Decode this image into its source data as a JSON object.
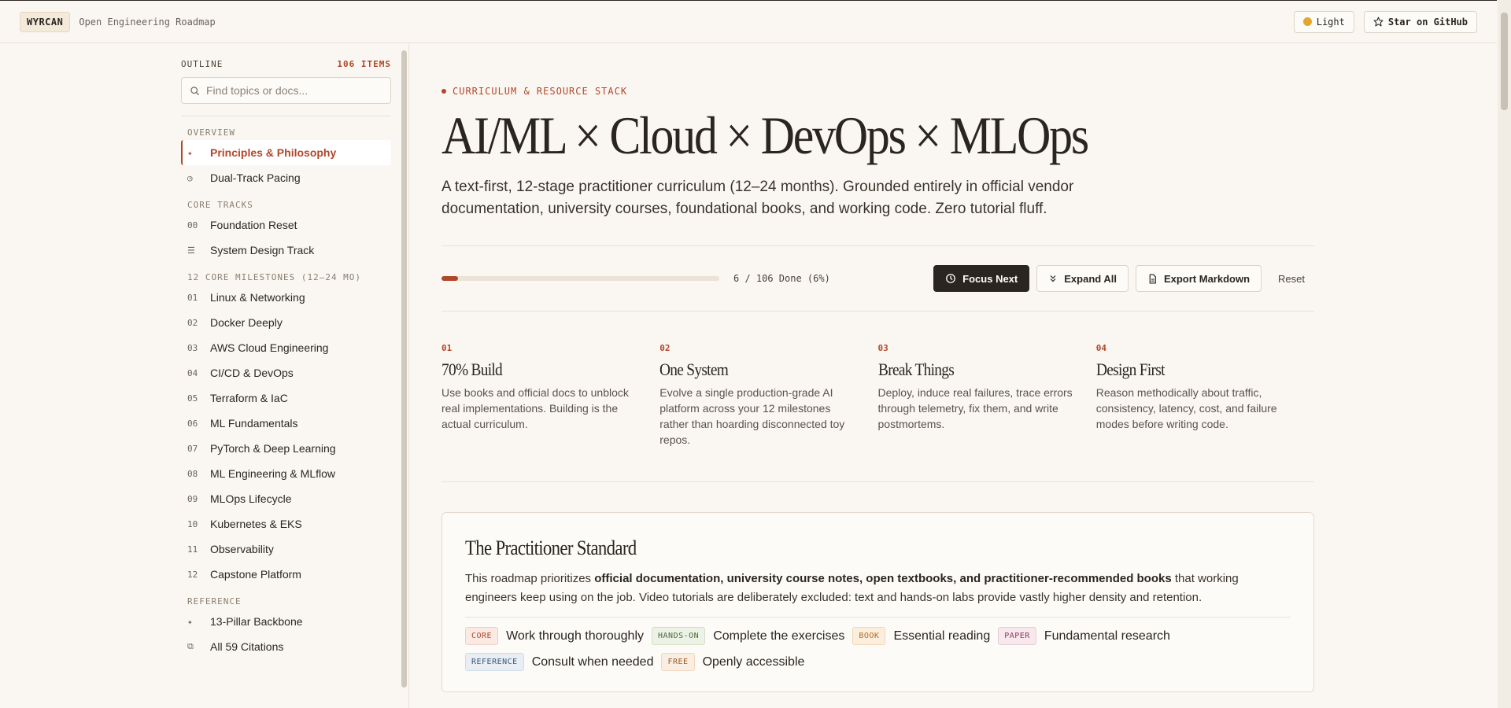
{
  "header": {
    "logo": "WYRCAN",
    "subtitle": "Open Engineering Roadmap",
    "theme_label": "Light",
    "github_label": "Star on GitHub"
  },
  "sidebar": {
    "outline_label": "OUTLINE",
    "count_label": "106 ITEMS",
    "search_placeholder": "Find topics or docs...",
    "sections": [
      {
        "label": "OVERVIEW",
        "items": [
          {
            "icon": "✦",
            "label": "Principles & Philosophy",
            "active": true
          },
          {
            "icon": "◷",
            "label": "Dual-Track Pacing"
          }
        ]
      },
      {
        "label": "CORE TRACKS",
        "items": [
          {
            "icon": "00",
            "label": "Foundation Reset"
          },
          {
            "icon": "☰",
            "label": "System Design Track"
          }
        ]
      },
      {
        "label": "12 CORE MILESTONES (12–24 MO)",
        "items": [
          {
            "icon": "01",
            "label": "Linux & Networking"
          },
          {
            "icon": "02",
            "label": "Docker Deeply"
          },
          {
            "icon": "03",
            "label": "AWS Cloud Engineering"
          },
          {
            "icon": "04",
            "label": "CI/CD & DevOps"
          },
          {
            "icon": "05",
            "label": "Terraform & IaC"
          },
          {
            "icon": "06",
            "label": "ML Fundamentals"
          },
          {
            "icon": "07",
            "label": "PyTorch & Deep Learning"
          },
          {
            "icon": "08",
            "label": "ML Engineering & MLflow"
          },
          {
            "icon": "09",
            "label": "MLOps Lifecycle"
          },
          {
            "icon": "10",
            "label": "Kubernetes & EKS"
          },
          {
            "icon": "11",
            "label": "Observability"
          },
          {
            "icon": "12",
            "label": "Capstone Platform"
          }
        ]
      },
      {
        "label": "REFERENCE",
        "items": [
          {
            "icon": "✦",
            "label": "13-Pillar Backbone"
          },
          {
            "icon": "⧉",
            "label": "All 59 Citations"
          }
        ]
      }
    ]
  },
  "hero": {
    "eyebrow": "CURRICULUM & RESOURCE STACK",
    "title": "AI/ML × Cloud × DevOps × MLOps",
    "subtitle": "A text-first, 12-stage practitioner curriculum (12–24 months). Grounded entirely in official vendor documentation, university courses, foundational books, and working code. Zero tutorial fluff."
  },
  "progress": {
    "done": 6,
    "total": 106,
    "fraction": 0.06,
    "text": "6 / 106 Done (6%)",
    "focus_label": "Focus Next",
    "expand_label": "Expand All",
    "export_label": "Export Markdown",
    "reset_label": "Reset"
  },
  "principles": [
    {
      "num": "01",
      "title": "70% Build",
      "desc": "Use books and official docs to unblock real implementations. Building is the actual curriculum."
    },
    {
      "num": "02",
      "title": "One System",
      "desc": "Evolve a single production-grade AI platform across your 12 milestones rather than hoarding disconnected toy repos."
    },
    {
      "num": "03",
      "title": "Break Things",
      "desc": "Deploy, induce real failures, trace errors through telemetry, fix them, and write postmortems."
    },
    {
      "num": "04",
      "title": "Design First",
      "desc": "Reason methodically about traffic, consistency, latency, cost, and failure modes before writing code."
    }
  ],
  "standard": {
    "title": "The Practitioner Standard",
    "text_before": "This roadmap prioritizes ",
    "text_bold": "official documentation, university course notes, open textbooks, and practitioner-recommended books",
    "text_after": " that working engineers keep using on the job. Video tutorials are deliberately excluded: text and hands-on labs provide vastly higher density and retention.",
    "legend": [
      {
        "tag": "CORE",
        "text": "Work through thoroughly",
        "color": "#b1472a",
        "bg": "#fbe9e3",
        "border": "#f0cfc4"
      },
      {
        "tag": "HANDS-ON",
        "text": "Complete the exercises",
        "color": "#4a6b3a",
        "bg": "#edf2e6",
        "border": "#d3dfc6"
      },
      {
        "tag": "BOOK",
        "text": "Essential reading",
        "color": "#b16a1f",
        "bg": "#fbeedd",
        "border": "#efd7b6"
      },
      {
        "tag": "PAPER",
        "text": "Fundamental research",
        "color": "#8a3a5a",
        "bg": "#f7e8ee",
        "border": "#e8cdd8"
      },
      {
        "tag": "REFERENCE",
        "text": "Consult when needed",
        "color": "#3a5a7a",
        "bg": "#e8eef4",
        "border": "#cfdbe7"
      },
      {
        "tag": "FREE",
        "text": "Openly accessible",
        "color": "#9a5a2a",
        "bg": "#faeee2",
        "border": "#eed8c2"
      }
    ]
  }
}
